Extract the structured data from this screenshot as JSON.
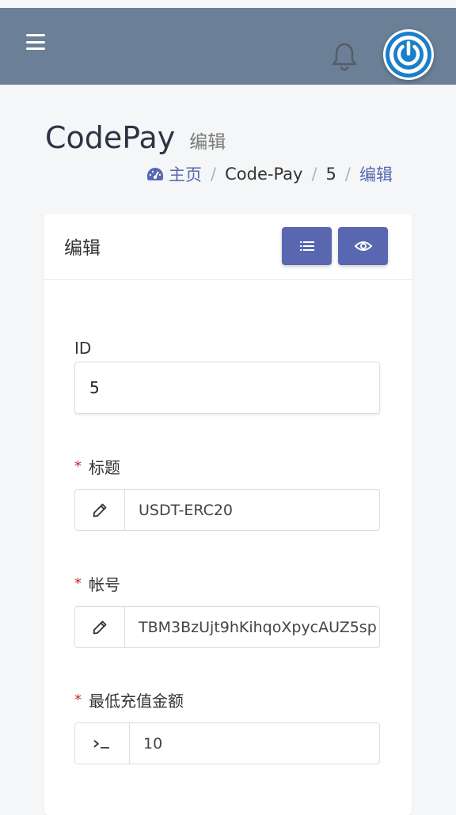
{
  "header": {
    "icons": {
      "menu": "hamburger-icon",
      "notifications": "bell-icon",
      "avatar": "power-icon"
    },
    "colors": {
      "bar": "#6b8096",
      "avatar_ring": "#1b7ec8"
    }
  },
  "page": {
    "title": "CodePay",
    "subtitle": "编辑"
  },
  "breadcrumb": {
    "home_icon": "dashboard-icon",
    "items": [
      "主页",
      "Code-Pay",
      "5",
      "编辑"
    ],
    "separator": "/"
  },
  "card": {
    "title": "编辑",
    "buttons": {
      "list_icon": "list-icon",
      "view_icon": "eye-icon"
    },
    "accent": "#5867b0"
  },
  "form": {
    "id": {
      "label": "ID",
      "value": "5"
    },
    "title": {
      "required_mark": "*",
      "label": "标题",
      "icon": "pencil-icon",
      "value": "USDT-ERC20"
    },
    "account": {
      "required_mark": "*",
      "label": "帐号",
      "icon": "pencil-icon",
      "value": "TBM3BzUjt9hKihqoXpycAUZ5sp"
    },
    "min_recharge": {
      "required_mark": "*",
      "label": "最低充值金额",
      "icon": "terminal-icon",
      "value": "10"
    }
  }
}
